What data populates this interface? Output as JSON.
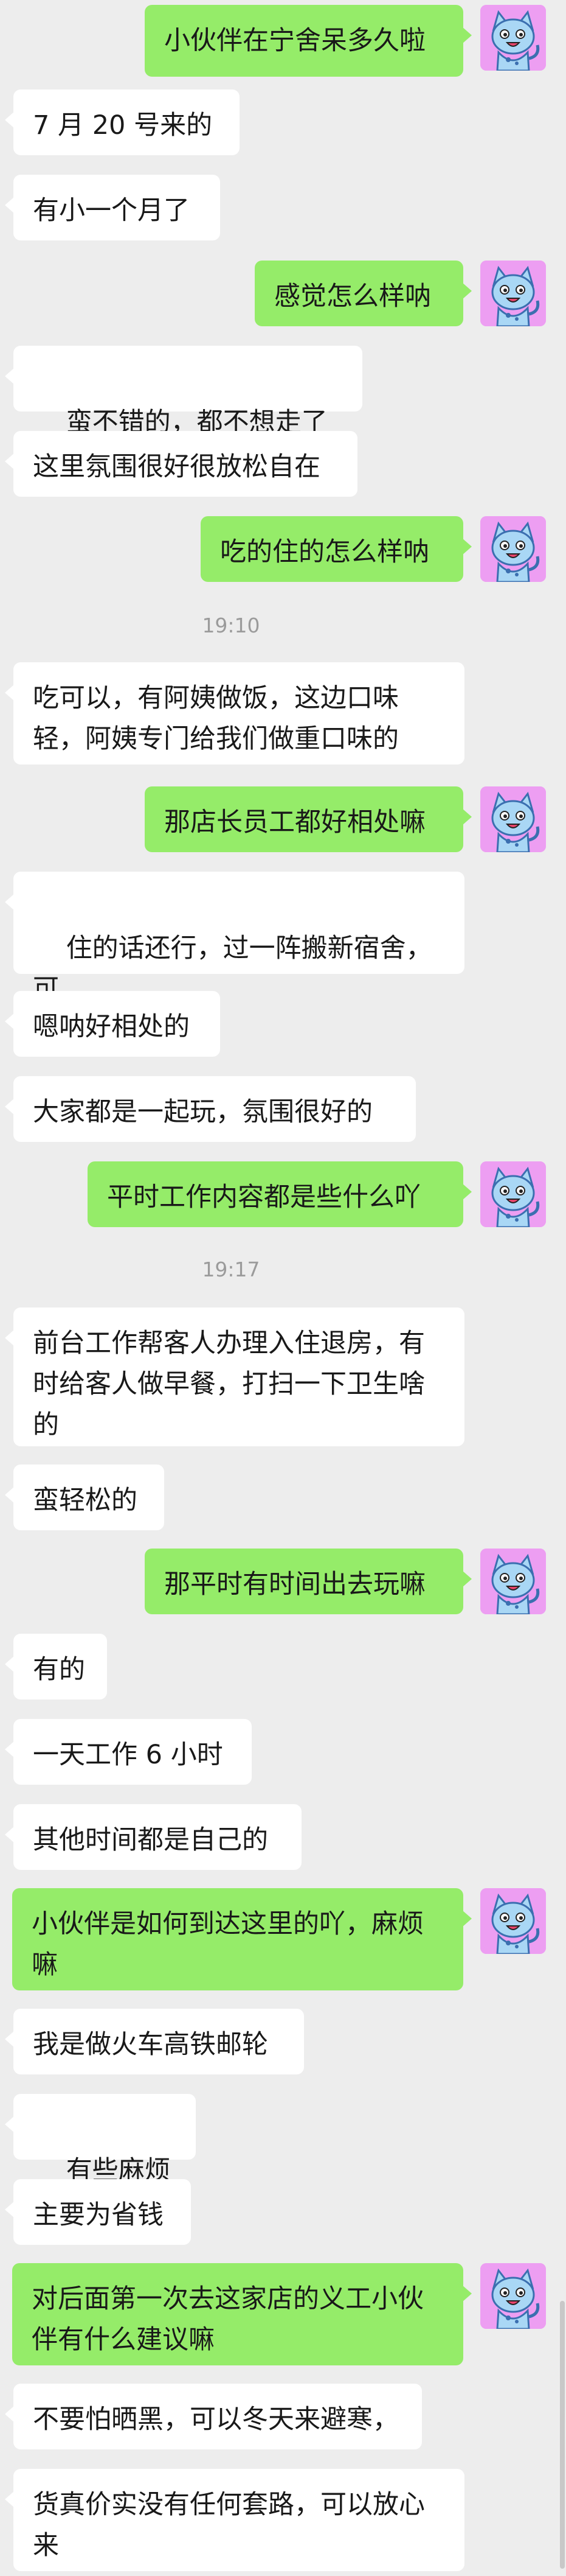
{
  "me_avatar_icon": "cartoon-cat-avatar-icon",
  "colors": {
    "background": "#ededed",
    "outgoing": "#95ec69",
    "incoming": "#ffffff",
    "avatar_bg": "#ed9ef2"
  },
  "messages": [
    {
      "dir": "out",
      "text": "小伙伴在宁舍呆多久啦"
    },
    {
      "dir": "in",
      "text": "7 月 20 号来的"
    },
    {
      "dir": "in",
      "text": "有小一个月了"
    },
    {
      "dir": "out",
      "text": "感觉怎么样呐"
    },
    {
      "dir": "in",
      "text": "蛮不错的，都不想走了",
      "emoji": "crying-laughing-emoji-icon"
    },
    {
      "dir": "in",
      "text": "这里氛围很好很放松自在"
    },
    {
      "dir": "out",
      "text": "吃的住的怎么样呐"
    },
    {
      "dir": "time",
      "text": "19:10"
    },
    {
      "dir": "in",
      "text": "吃可以，有阿姨做饭，这边口味\n轻，阿姨专门给我们做重口味的"
    },
    {
      "dir": "out",
      "text": "那店长员工都好相处嘛"
    },
    {
      "dir": "in",
      "text": "住的话还行，过一阵搬新宿舍，可\n惜赶不上了",
      "emoji": "crying-laughing-emoji-icon"
    },
    {
      "dir": "in",
      "text": "嗯呐好相处的"
    },
    {
      "dir": "in",
      "text": "大家都是一起玩，氛围很好的"
    },
    {
      "dir": "out",
      "text": "平时工作内容都是些什么吖"
    },
    {
      "dir": "time",
      "text": "19:17"
    },
    {
      "dir": "in",
      "text": "前台工作帮客人办理入住退房，有\n时给客人做早餐，打扫一下卫生啥\n的"
    },
    {
      "dir": "in",
      "text": "蛮轻松的"
    },
    {
      "dir": "out",
      "text": "那平时有时间出去玩嘛"
    },
    {
      "dir": "in",
      "text": "有的"
    },
    {
      "dir": "in",
      "text": "一天工作 6 小时"
    },
    {
      "dir": "in",
      "text": "其他时间都是自己的"
    },
    {
      "dir": "out",
      "text": "小伙伴是如何到达这里的吖，麻烦\n嘛"
    },
    {
      "dir": "in",
      "text": "我是做火车高铁邮轮"
    },
    {
      "dir": "in",
      "text": "有些麻烦",
      "emoji": "grinning-sweat-emoji-icon"
    },
    {
      "dir": "in",
      "text": "主要为省钱"
    },
    {
      "dir": "out",
      "text": "对后面第一次去这家店的义工小伙\n伴有什么建议嘛"
    },
    {
      "dir": "in",
      "text": "不要怕晒黑，可以冬天来避寒，"
    },
    {
      "dir": "in",
      "text": "货真价实没有任何套路，可以放心\n来"
    }
  ]
}
